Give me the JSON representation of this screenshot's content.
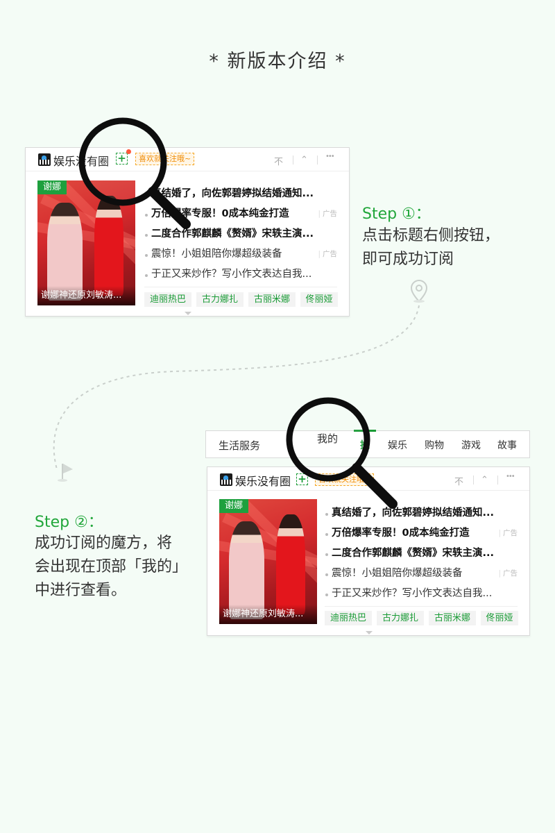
{
  "page_title": "* 新版本介绍 *",
  "colors": {
    "accent": "#21a63a",
    "background": "#f4fcf6",
    "ad_orange": "#f08a00"
  },
  "card": {
    "channel_name": "娱乐没有圈",
    "plus_icon": "plus-in-dashed-box",
    "follow_tip": "喜欢就关注哦~",
    "controls": {
      "pin": "不",
      "collapse": "⌃",
      "more": "•••"
    },
    "thumbnail": {
      "tag": "谢娜",
      "caption": "谢娜神还原刘敏涛..."
    },
    "news": [
      {
        "text": "真结婚了，向佐郭碧婷拟结婚通知...",
        "bold": true,
        "ad": ""
      },
      {
        "text": "万倍爆率专服！0成本纯金打造",
        "bold": true,
        "ad": "广告"
      },
      {
        "text": "二度合作郭麒麟《赘婿》宋轶主演...",
        "bold": true,
        "ad": ""
      },
      {
        "text": "震惊！小姐姐陪你爆超级装备",
        "bold": false,
        "ad": "广告"
      },
      {
        "text": "于正又来炒作？写小作文表达自我...",
        "bold": false,
        "ad": ""
      }
    ],
    "chips": [
      "迪丽热巴",
      "古力娜扎",
      "古丽米娜",
      "佟丽娅"
    ]
  },
  "card2": {
    "follow_tip": "喜欢就关注哦~"
  },
  "navbar": {
    "items": [
      "生活服务",
      "我的",
      "推",
      "娱乐",
      "购物",
      "游戏",
      "故事"
    ]
  },
  "step1": {
    "label": "Step ①：",
    "lines": [
      "点击标题右侧按钮，",
      "即可成功订阅"
    ]
  },
  "step2": {
    "label": "Step ②：",
    "lines": [
      "成功订阅的魔方，将",
      "会出现在顶部「我的」",
      "中进行查看。"
    ]
  }
}
